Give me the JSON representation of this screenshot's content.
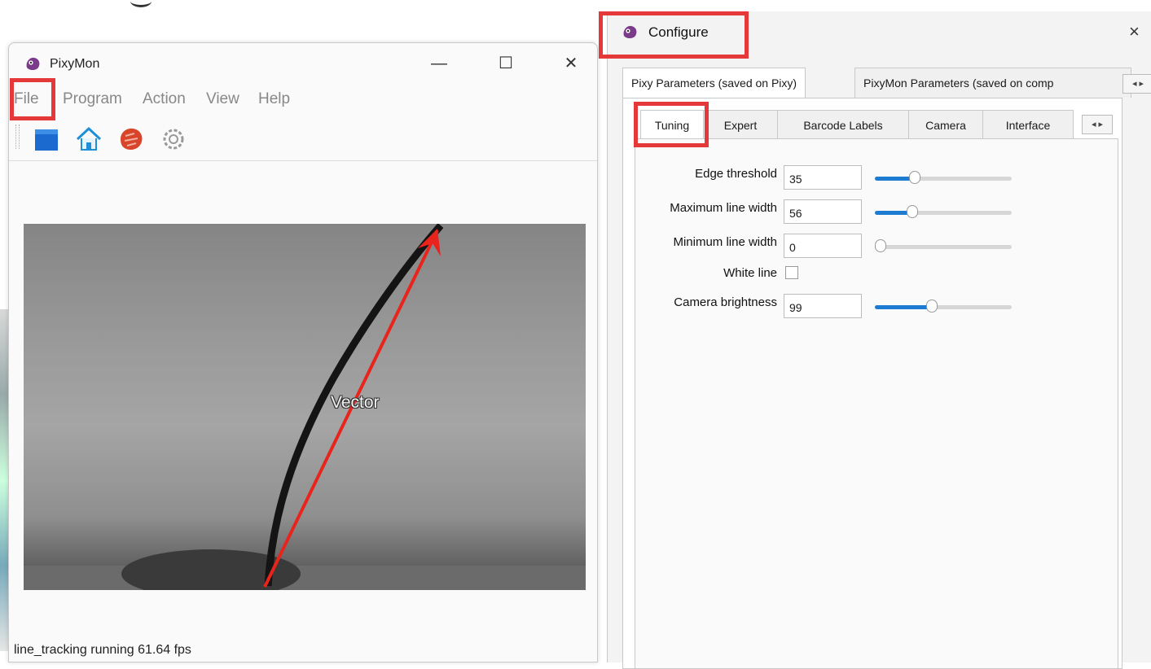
{
  "pixymon": {
    "title": "PixyMon",
    "menu": [
      "File",
      "Program",
      "Action",
      "View",
      "Help"
    ],
    "toolbar_icons": [
      "stop-icon",
      "home-icon",
      "raw-video-icon",
      "settings-icon"
    ],
    "video_label": "Vector",
    "status": "line_tracking running 61.64 fps"
  },
  "configure": {
    "title": "Configure",
    "outer_tabs": [
      "Pixy Parameters (saved on Pixy)",
      "PixyMon Parameters (saved on comp"
    ],
    "inner_tabs": [
      "Tuning",
      "Expert",
      "Barcode Labels",
      "Camera",
      "Interface"
    ],
    "params": [
      {
        "label": "Edge threshold",
        "value": "35",
        "level": 0.27
      },
      {
        "label": "Maximum line width",
        "value": "56",
        "level": 0.25
      },
      {
        "label": "Minimum line width",
        "value": "0",
        "level": 0.0
      },
      {
        "label": "White line",
        "checked": false
      },
      {
        "label": "Camera brightness",
        "value": "99",
        "level": 0.41
      }
    ],
    "close_glyph": "×"
  },
  "colors": {
    "accent": "#1e7bd2",
    "highlight": "#e53939",
    "vector": "#e8241c"
  }
}
